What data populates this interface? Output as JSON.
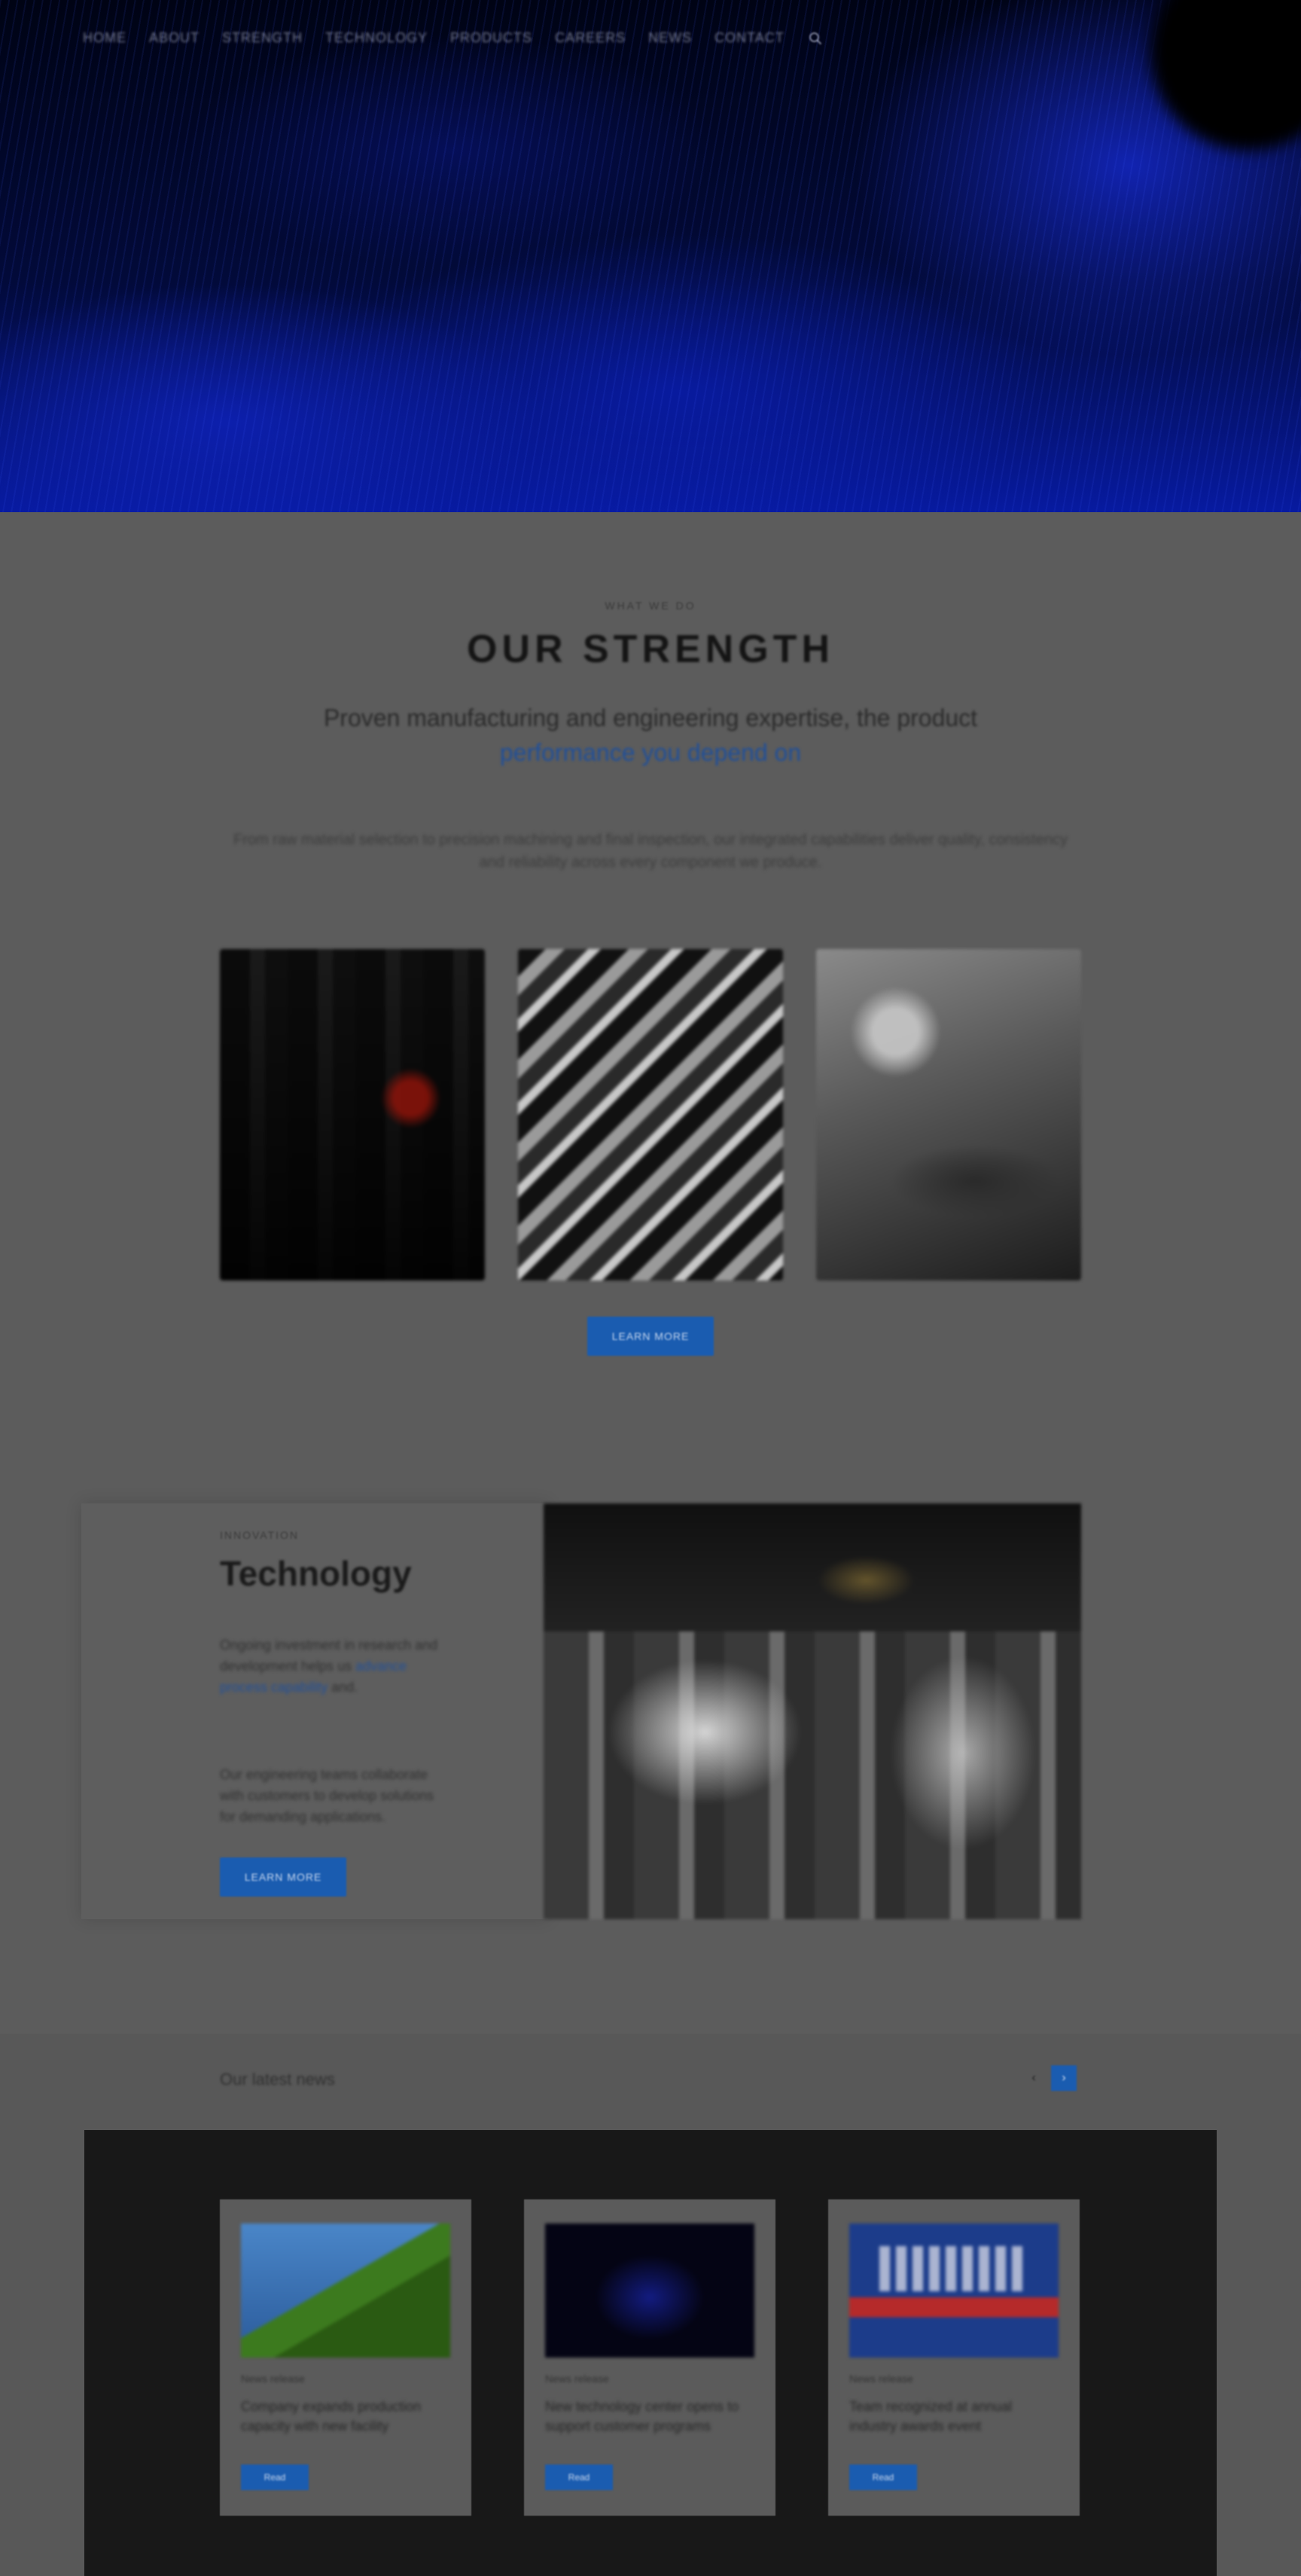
{
  "nav": {
    "items": [
      "Home",
      "About",
      "Strength",
      "Technology",
      "Products",
      "Careers",
      "News",
      "Contact"
    ],
    "search_icon": "search-icon"
  },
  "strength": {
    "eyebrow": "WHAT WE DO",
    "title": "OUR STRENGTH",
    "subtitle": "Proven manufacturing and engineering expertise, the product",
    "subtitle_link": "performance you depend on",
    "body": "From raw material selection to precision machining and final inspection, our integrated capabilities deliver quality, consistency and reliability across every component we produce.",
    "button_label": "Learn More"
  },
  "technology": {
    "eyebrow": "INNOVATION",
    "title": "Technology",
    "text_before_link": "Ongoing investment in research and development helps us",
    "text_link": "advance process capability",
    "text_after_link": "and.",
    "text2": "Our engineering teams collaborate with customers to develop solutions for demanding applications.",
    "button_label": "Learn More"
  },
  "news": {
    "heading": "Our latest news",
    "prev_icon": "chevron-left-icon",
    "next_icon": "chevron-right-icon",
    "cards": [
      {
        "date": "News release",
        "title": "Company expands production capacity with new facility",
        "button": "Read"
      },
      {
        "date": "News release",
        "title": "New technology center opens to support customer programs",
        "button": "Read"
      },
      {
        "date": "News release",
        "title": "Team recognized at annual industry awards event",
        "button": "Read"
      }
    ]
  },
  "colors": {
    "accent": "#1a5cb0",
    "overlay": "#585858",
    "hero": "#020a3a"
  }
}
